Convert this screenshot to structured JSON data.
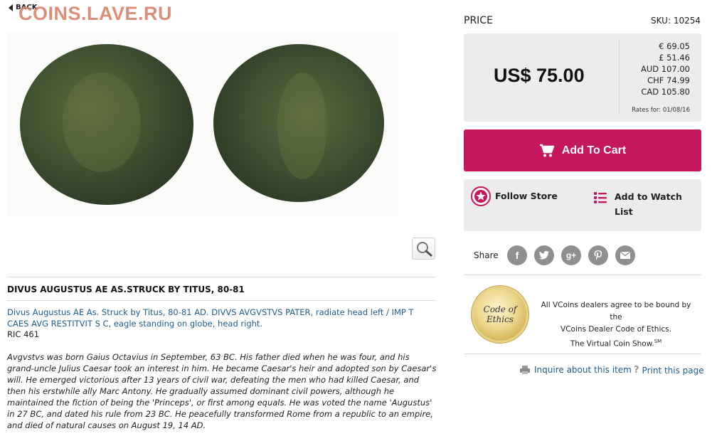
{
  "nav": {
    "back_label": "BACK"
  },
  "watermark": "COINS.LAVE.RU",
  "item": {
    "title": "DIVUS AUGUSTUS AE AS.STRUCK BY TITUS, 80-81",
    "description": "Divus Augustus AE As. Struck by Titus, 80-81 AD. DIVVS AVGVSTVS PATER, radiate head left / IMP T CAES AVG RESTITVIT S C, eagle standing on globe, head right.",
    "ric": "RIC 461",
    "story": "Avgvstvs was born Gaius Octavius in September, 63 BC. His father died when he was four, and his grand-uncle Julius Caesar took an interest in him. He became Caesar's heir and adopted son by Caesar's will. He emerged victorious after 13 years of civil war, defeating the men who had killed Caesar, and then his erstwhile ally Marc Antony. He gradually assumed dominant civil powers, although he maintained the fiction of being the 'Princeps', or first among equals. He was voted the name 'Augustus' in 27 BC, and dated his rule from 23 BC. He peacefully transformed Rome from a republic to an empire, and died of natural causes on August 19, 14 AD."
  },
  "price": {
    "label": "PRICE",
    "sku": "SKU: 10254",
    "main": "US$ 75.00",
    "conversions": [
      "€ 69.05",
      "£ 51.46",
      "AUD 107.00",
      "CHF 74.99",
      "CAD 105.80"
    ],
    "rates_note": "Rates for: 01/08/16"
  },
  "actions": {
    "cart_label": "Add To Cart",
    "follow_label": "Follow Store",
    "watch_label": "Add to Watch List",
    "share_label": "Share",
    "share_icons": [
      "facebook-icon",
      "twitter-icon",
      "google-plus-icon",
      "pinterest-icon",
      "email-icon"
    ]
  },
  "ethics": {
    "badge_line1": "Code of",
    "badge_line2": "Ethics",
    "text_line1": "All VCoins dealers agree to be bound by the",
    "text_line2": "VCoins Dealer Code of Ethics.",
    "text_line3": "The Virtual Coin Show.",
    "sm": "SM"
  },
  "footer_links": {
    "inquire": "Inquire about this item",
    "print": "Print this page"
  },
  "colors": {
    "accent": "#c4175e",
    "link": "#1f5d8c",
    "panel": "#ececec",
    "icon_gray": "#8f8f8f"
  }
}
